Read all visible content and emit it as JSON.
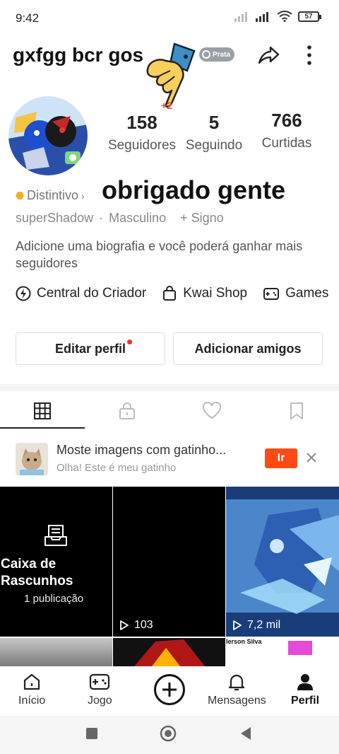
{
  "status_bar": {
    "time": "9:42",
    "battery": "57"
  },
  "header": {
    "username": "gxfgg bcr gos",
    "badge_label": "Prata",
    "sticker_count": "+2"
  },
  "stats": [
    {
      "value": "158",
      "label": "Seguidores"
    },
    {
      "value": "5",
      "label": "Seguindo"
    },
    {
      "value": "766",
      "label": "Curtidas"
    }
  ],
  "badge": {
    "label": "Distintivo"
  },
  "overlay_text": "obrigado gente",
  "info": {
    "handle": "superShadow",
    "separator": "·",
    "gender": "Masculino",
    "sign": "+ Signo"
  },
  "bio": "Adicione uma biografia e você poderá ganhar mais seguidores",
  "shortcuts": [
    {
      "label": "Central do Criador",
      "icon": "lightning-icon"
    },
    {
      "label": "Kwai Shop",
      "icon": "shopping-bag-icon"
    },
    {
      "label": "Games",
      "icon": "gamepad-icon"
    }
  ],
  "buttons": {
    "edit": "Editar perfil",
    "add_friends": "Adicionar amigos"
  },
  "tabs": [
    "grid-icon",
    "lock-icon",
    "heart-icon",
    "bookmark-icon"
  ],
  "promo": {
    "title": "Moste imagens com gatinho...",
    "subtitle": "Olha! Este é meu gatinho",
    "go": "Ir"
  },
  "grid": {
    "drafts_label": "Caixa de Rascunhos",
    "drafts_count": "1 publicação",
    "video1_views": "103",
    "video2_views": "7,2 mil",
    "tile_caption": "lerson Silva"
  },
  "bottom_nav": [
    {
      "label": "Início",
      "icon": "home-icon"
    },
    {
      "label": "Jogo",
      "icon": "gamepad-icon"
    },
    {
      "label": "Mensagens",
      "icon": "bell-icon"
    },
    {
      "label": "Perfil",
      "icon": "person-icon"
    }
  ],
  "colors": {
    "accent": "#fe4a14",
    "notification": "#ff2d2d",
    "badge_gold": "#f2b01e"
  }
}
